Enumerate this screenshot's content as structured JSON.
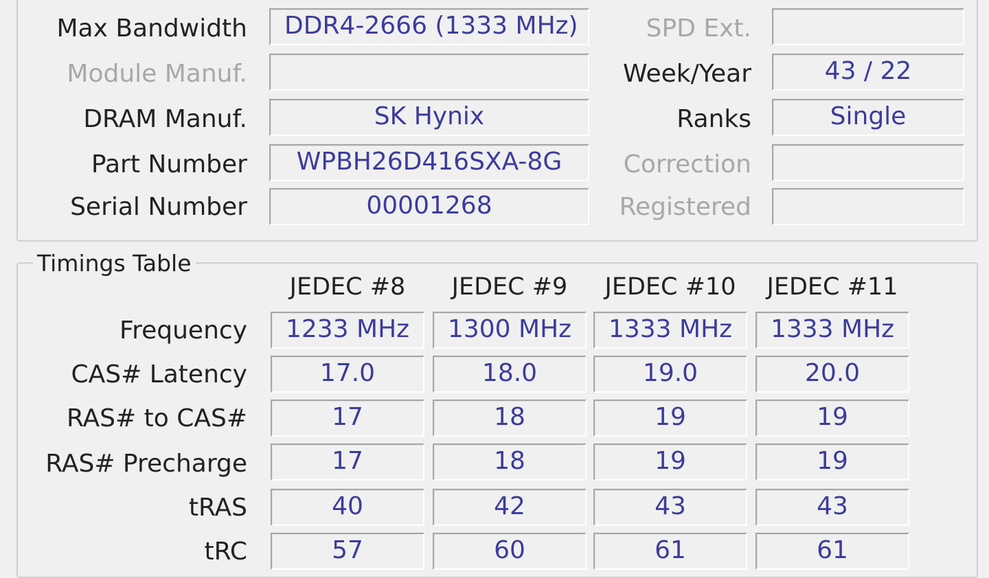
{
  "spd": {
    "rows": [
      {
        "label": "Max Bandwidth",
        "value": "DDR4-2666 (1333 MHz)",
        "disabled": false
      },
      {
        "label": "Module Manuf.",
        "value": "",
        "disabled": true
      },
      {
        "label": "DRAM Manuf.",
        "value": "SK Hynix",
        "disabled": false
      },
      {
        "label": "Part Number",
        "value": "WPBH26D416SXA-8G",
        "disabled": false
      },
      {
        "label": "Serial Number",
        "value": "00001268",
        "disabled": false
      }
    ],
    "right_rows": [
      {
        "label": "SPD Ext.",
        "value": "",
        "disabled": true
      },
      {
        "label": "Week/Year",
        "value": "43 / 22",
        "disabled": false
      },
      {
        "label": "Ranks",
        "value": "Single",
        "disabled": false
      },
      {
        "label": "Correction",
        "value": "",
        "disabled": true
      },
      {
        "label": "Registered",
        "value": "",
        "disabled": true
      }
    ]
  },
  "timings": {
    "title": "Timings Table",
    "columns": [
      "JEDEC #8",
      "JEDEC #9",
      "JEDEC #10",
      "JEDEC #11"
    ],
    "rows": [
      {
        "label": "Frequency",
        "values": [
          "1233 MHz",
          "1300 MHz",
          "1333 MHz",
          "1333 MHz"
        ]
      },
      {
        "label": "CAS# Latency",
        "values": [
          "17.0",
          "18.0",
          "19.0",
          "20.0"
        ]
      },
      {
        "label": "RAS# to CAS#",
        "values": [
          "17",
          "18",
          "19",
          "19"
        ]
      },
      {
        "label": "RAS# Precharge",
        "values": [
          "17",
          "18",
          "19",
          "19"
        ]
      },
      {
        "label": "tRAS",
        "values": [
          "40",
          "42",
          "43",
          "43"
        ]
      },
      {
        "label": "tRC",
        "values": [
          "57",
          "60",
          "61",
          "61"
        ]
      }
    ]
  }
}
